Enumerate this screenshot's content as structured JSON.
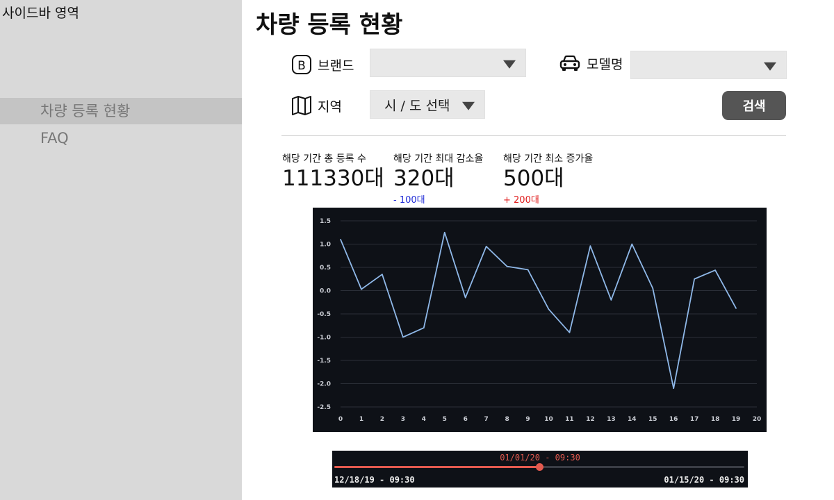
{
  "sidebar": {
    "title": "사이드바 영역",
    "items": [
      {
        "label": "차량 등록 현황",
        "active": true
      },
      {
        "label": "FAQ",
        "active": false
      }
    ]
  },
  "main": {
    "title": "차량 등록 현황",
    "filters": {
      "brand": {
        "label": "브랜드",
        "icon": "letter-b-icon",
        "value": ""
      },
      "model": {
        "label": "모델명",
        "icon": "car-icon",
        "value": ""
      },
      "region": {
        "label": "지역",
        "icon": "map-icon",
        "value": "시 / 도 선택"
      },
      "search_label": "검색"
    },
    "metrics": [
      {
        "label": "해당 기간 총 등록 수",
        "value": "111330대",
        "delta": ""
      },
      {
        "label": "해당 기간 최대 감소율",
        "value": "320대",
        "delta": "- 100대",
        "delta_color": "#1e2ad6"
      },
      {
        "label": "해당 기간 최소 증가율",
        "value": "500대",
        "delta": "+ 200대",
        "delta_color": "#e01b1b"
      }
    ]
  },
  "chart_data": {
    "type": "line",
    "x": [
      0,
      1,
      2,
      3,
      4,
      5,
      6,
      7,
      8,
      9,
      10,
      11,
      12,
      13,
      14,
      15,
      16,
      17,
      18,
      19
    ],
    "series": [
      {
        "values": [
          1.1,
          0.03,
          0.35,
          -1.0,
          -0.8,
          1.25,
          -0.15,
          0.95,
          0.52,
          0.45,
          -0.4,
          -0.9,
          0.96,
          -0.2,
          1.0,
          0.05,
          -2.1,
          0.25,
          0.44,
          -0.38
        ],
        "color": "#8fb8e8"
      }
    ],
    "xticks": [
      0,
      1,
      2,
      3,
      4,
      5,
      6,
      7,
      8,
      9,
      10,
      11,
      12,
      13,
      14,
      15,
      16,
      17,
      18,
      19,
      20
    ],
    "yticks": [
      1.5,
      1.0,
      0.5,
      0.0,
      -0.5,
      -1.0,
      -1.5,
      -2.0,
      -2.5
    ],
    "ytick_labels": [
      "1.5",
      "1.0",
      "0.5",
      "0.0",
      "-0.5",
      "-1.0",
      "-1.5",
      "-2.0",
      "-2.5"
    ],
    "xlim": [
      0,
      20
    ],
    "ylim": [
      -2.5,
      1.5
    ],
    "grid": true,
    "background": "#0e1117"
  },
  "timeline": {
    "current": "01/01/20 - 09:30",
    "start": "12/18/19 - 09:30",
    "end": "01/15/20 - 09:30",
    "progress": 0.5,
    "color": "#e35a4f"
  }
}
